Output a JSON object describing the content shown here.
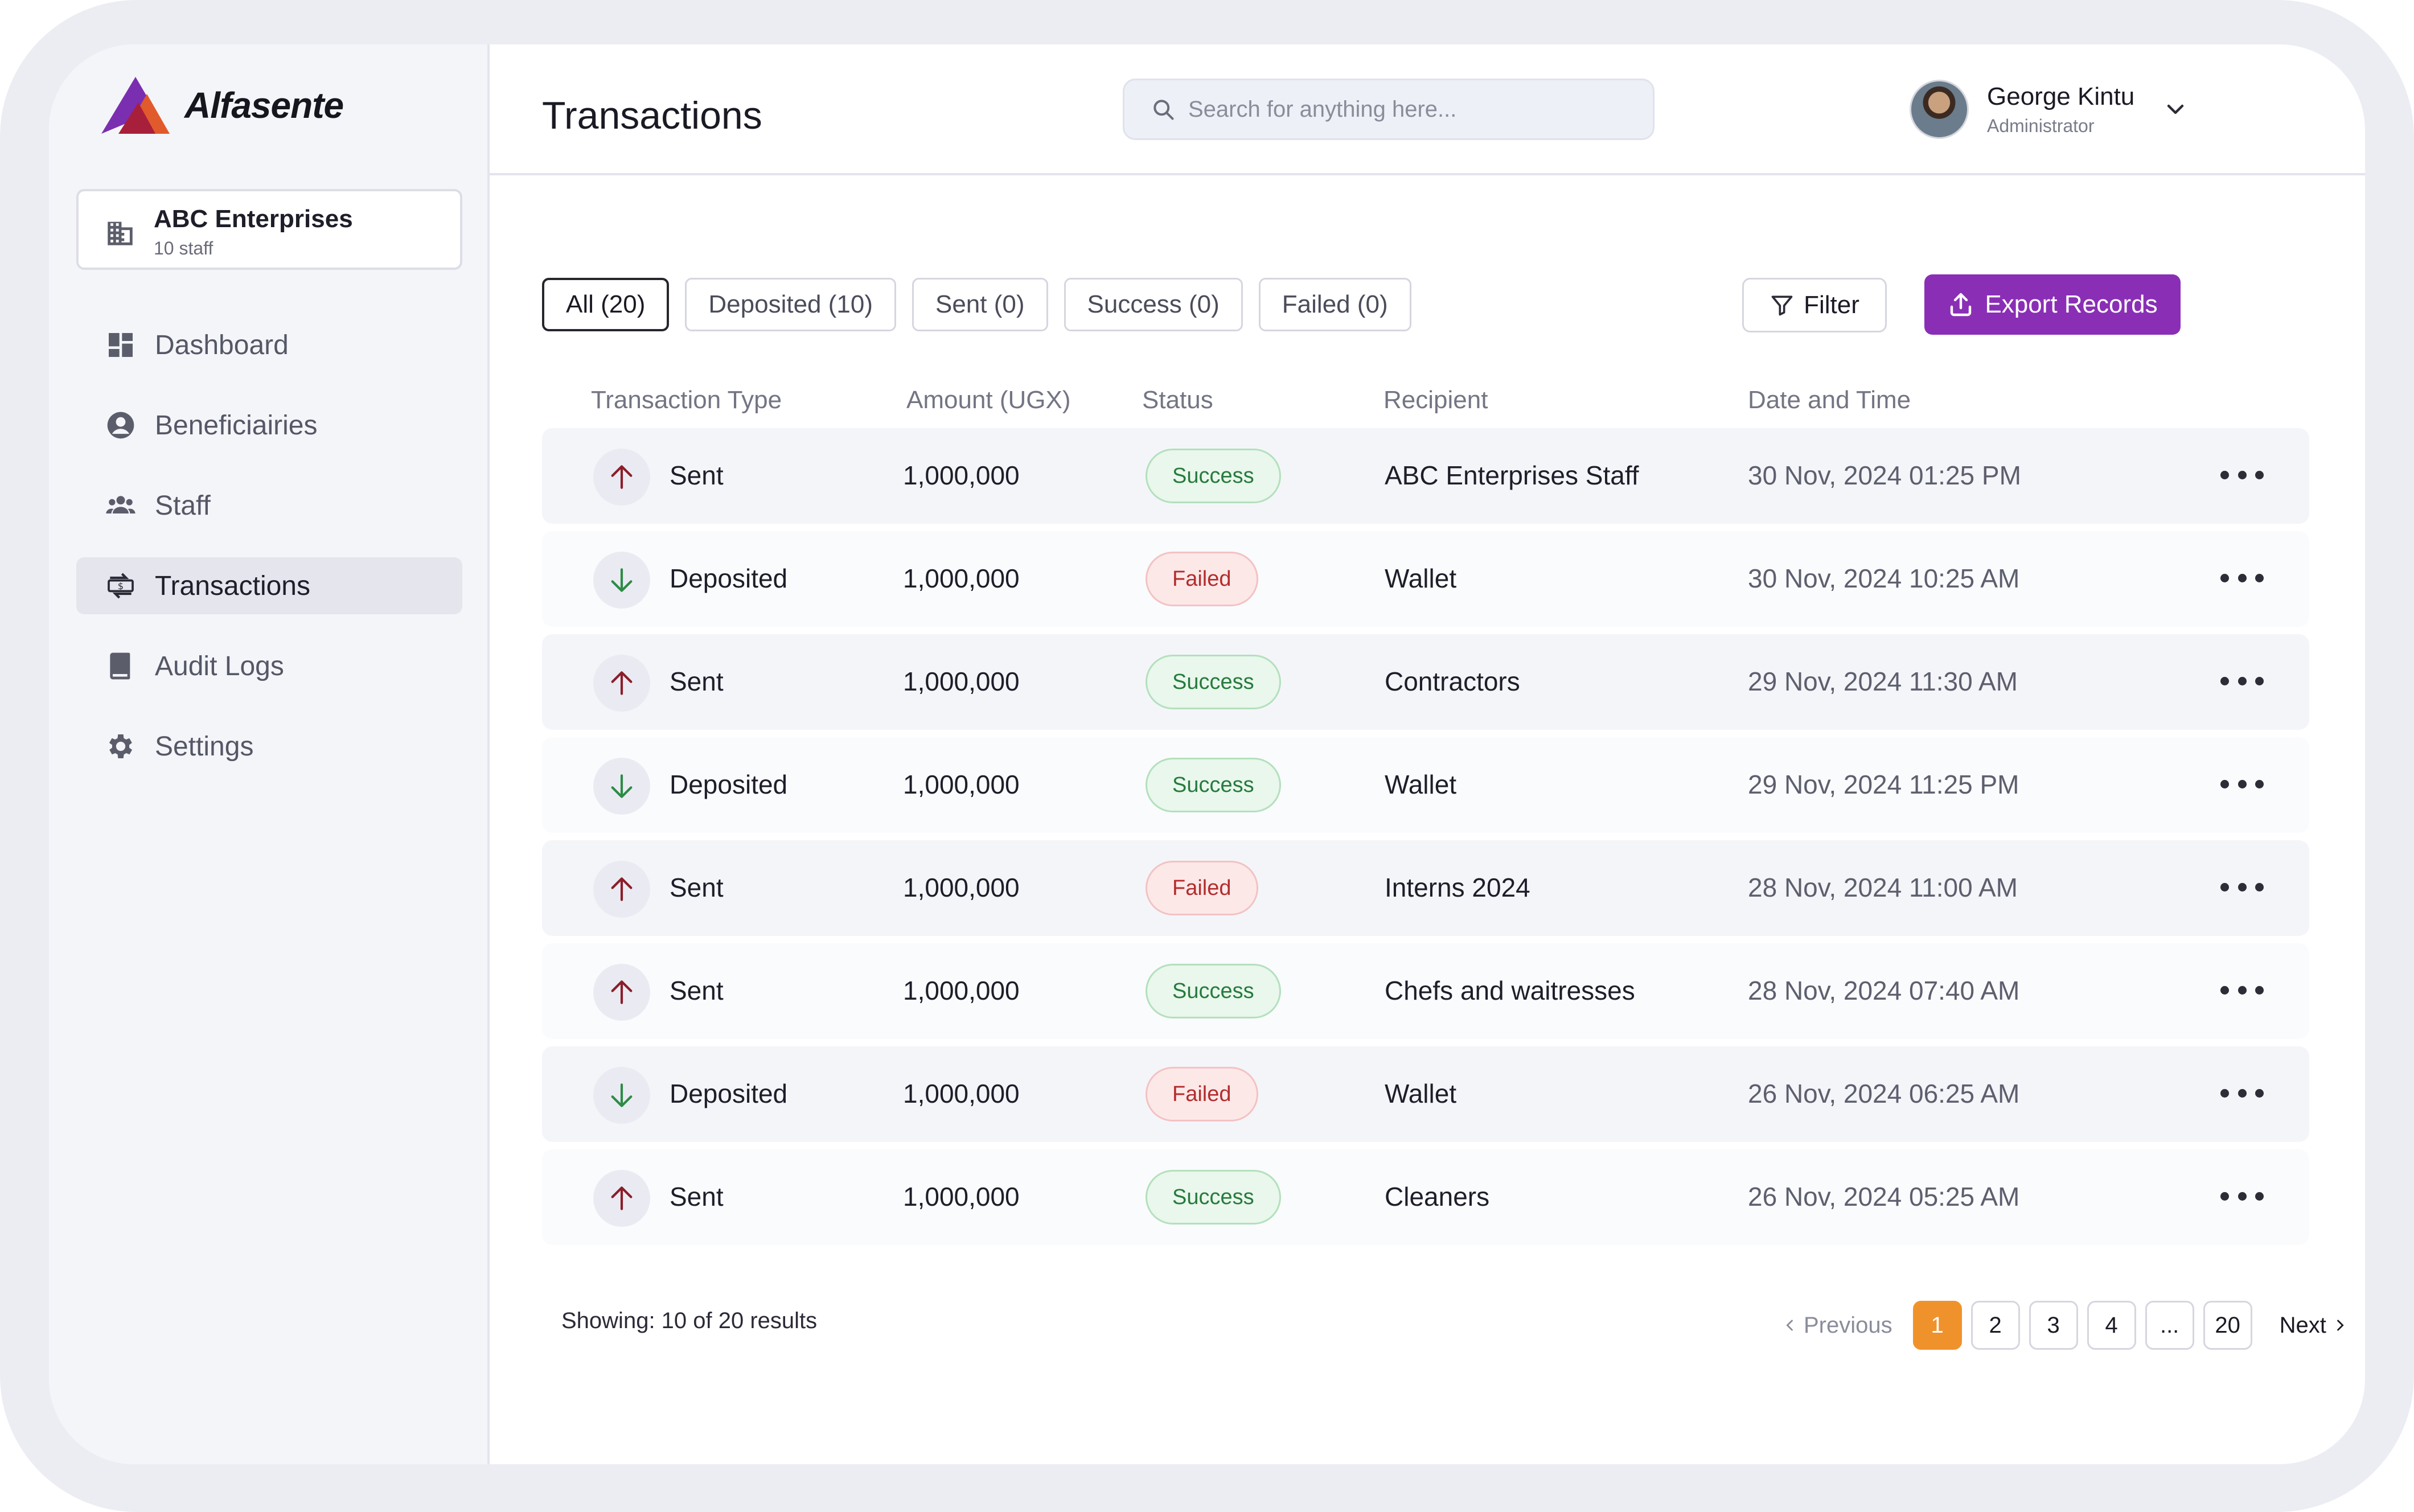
{
  "app": {
    "brand": "Alfasente"
  },
  "org": {
    "name": "ABC Enterprises",
    "sub": "10 staff"
  },
  "nav": [
    {
      "label": "Dashboard",
      "icon": "dashboard-icon"
    },
    {
      "label": "Beneficiairies",
      "icon": "user-circle-icon"
    },
    {
      "label": "Staff",
      "icon": "group-icon"
    },
    {
      "label": "Transactions",
      "icon": "transactions-icon",
      "active": true
    },
    {
      "label": "Audit Logs",
      "icon": "book-icon"
    },
    {
      "label": "Settings",
      "icon": "gear-icon"
    }
  ],
  "header": {
    "title": "Transactions",
    "search_placeholder": "Search for anything here...",
    "user": {
      "name": "George Kintu",
      "role": "Administrator"
    }
  },
  "filters": {
    "chips": [
      "All (20)",
      "Deposited (10)",
      "Sent (0)",
      "Success (0)",
      "Failed (0)"
    ],
    "active_chip": "All (20)",
    "filter_label": "Filter",
    "export_label": "Export Records"
  },
  "table": {
    "columns": [
      "Transaction Type",
      "Amount (UGX)",
      "Status",
      "Recipient",
      "Date and Time"
    ],
    "rows": [
      {
        "type": "Sent",
        "amount": "1,000,000",
        "status": "Success",
        "recipient": "ABC Enterprises Staff",
        "datetime": "30 Nov, 2024 01:25 PM"
      },
      {
        "type": "Deposited",
        "amount": "1,000,000",
        "status": "Failed",
        "recipient": "Wallet",
        "datetime": "30 Nov, 2024 10:25 AM"
      },
      {
        "type": "Sent",
        "amount": "1,000,000",
        "status": "Success",
        "recipient": "Contractors",
        "datetime": "29 Nov, 2024 11:30 AM"
      },
      {
        "type": "Deposited",
        "amount": "1,000,000",
        "status": "Success",
        "recipient": "Wallet",
        "datetime": "29 Nov, 2024 11:25 PM"
      },
      {
        "type": "Sent",
        "amount": "1,000,000",
        "status": "Failed",
        "recipient": "Interns 2024",
        "datetime": "28 Nov, 2024 11:00 AM"
      },
      {
        "type": "Sent",
        "amount": "1,000,000",
        "status": "Success",
        "recipient": "Chefs and waitresses",
        "datetime": "28 Nov, 2024 07:40 AM"
      },
      {
        "type": "Deposited",
        "amount": "1,000,000",
        "status": "Failed",
        "recipient": "Wallet",
        "datetime": "26 Nov, 2024 06:25 AM"
      },
      {
        "type": "Sent",
        "amount": "1,000,000",
        "status": "Success",
        "recipient": "Cleaners",
        "datetime": "26 Nov, 2024 05:25 AM"
      }
    ]
  },
  "footer": {
    "showing": "Showing: 10 of 20 results",
    "prev_label": "Previous",
    "next_label": "Next",
    "pages": [
      "1",
      "2",
      "3",
      "4",
      "...",
      "20"
    ],
    "current_page": "1"
  },
  "colors": {
    "accent": "#8a2fb5",
    "page_active": "#f0922c",
    "success": "#277a3d",
    "failed": "#b32d2d",
    "sent_arrow": "#8b1e2a",
    "deposit_arrow": "#2e8b47"
  }
}
